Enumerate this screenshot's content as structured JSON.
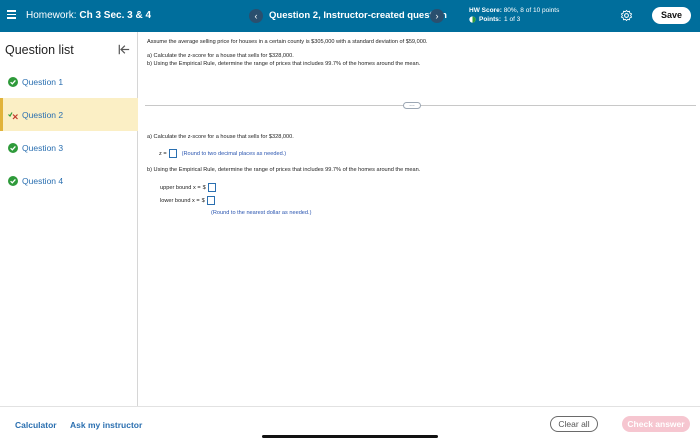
{
  "header": {
    "hw_label": "Homework:",
    "hw_name": "Ch 3 Sec. 3 & 4",
    "question_title": "Question 2, Instructor-created question",
    "score_label": "HW Score:",
    "score_value": "80%, 8 of 10 points",
    "points_label": "Points:",
    "points_value": "1 of 3",
    "save_label": "Save",
    "icons": {
      "menu": "hamburger-icon",
      "prev": "chevron-left-icon",
      "next": "chevron-right-icon",
      "points": "partial-credit-icon",
      "settings": "gear-icon"
    }
  },
  "sidebar": {
    "title": "Question list",
    "collapse_icon": "collapse-left-icon",
    "items": [
      {
        "label": "Question 1",
        "status": "correct"
      },
      {
        "label": "Question 2",
        "status": "partial",
        "active": true
      },
      {
        "label": "Question 3",
        "status": "correct"
      },
      {
        "label": "Question 4",
        "status": "correct"
      }
    ]
  },
  "question": {
    "intro": "Assume the average selling price for houses in a certain county is $305,000 with a standard deviation of $59,000.",
    "part_a_summary": "a) Calculate the z-score for a house that sells for $328,000.",
    "part_b_summary": "b) Using the Empirical Rule, determine the range of prices that includes 99.7% of the homes around the mean.",
    "more_label": "…",
    "part_a": "a) Calculate the z-score for a house that sells for $328,000.",
    "z_label": "z =",
    "z_hint": "(Round to two decimal places as needed.)",
    "part_b": "b) Using the Empirical Rule, determine the range of prices that includes 99.7% of the homes around the mean.",
    "upper_label": "upper bound x =",
    "lower_label": "lower bound x =",
    "dollar": "$",
    "bounds_hint": "(Round to the nearest dollar as needed.)"
  },
  "footer": {
    "calculator": "Calculator",
    "ask_instructor": "Ask my instructor",
    "clear_all": "Clear all",
    "check_answer": "Check answer"
  },
  "colors": {
    "header_bg": "#006e9c",
    "link_blue": "#2a6fb0",
    "correct_green": "#2e9a3a",
    "active_bg": "#fbefc5",
    "check_disabled": "#f6c6d0"
  }
}
